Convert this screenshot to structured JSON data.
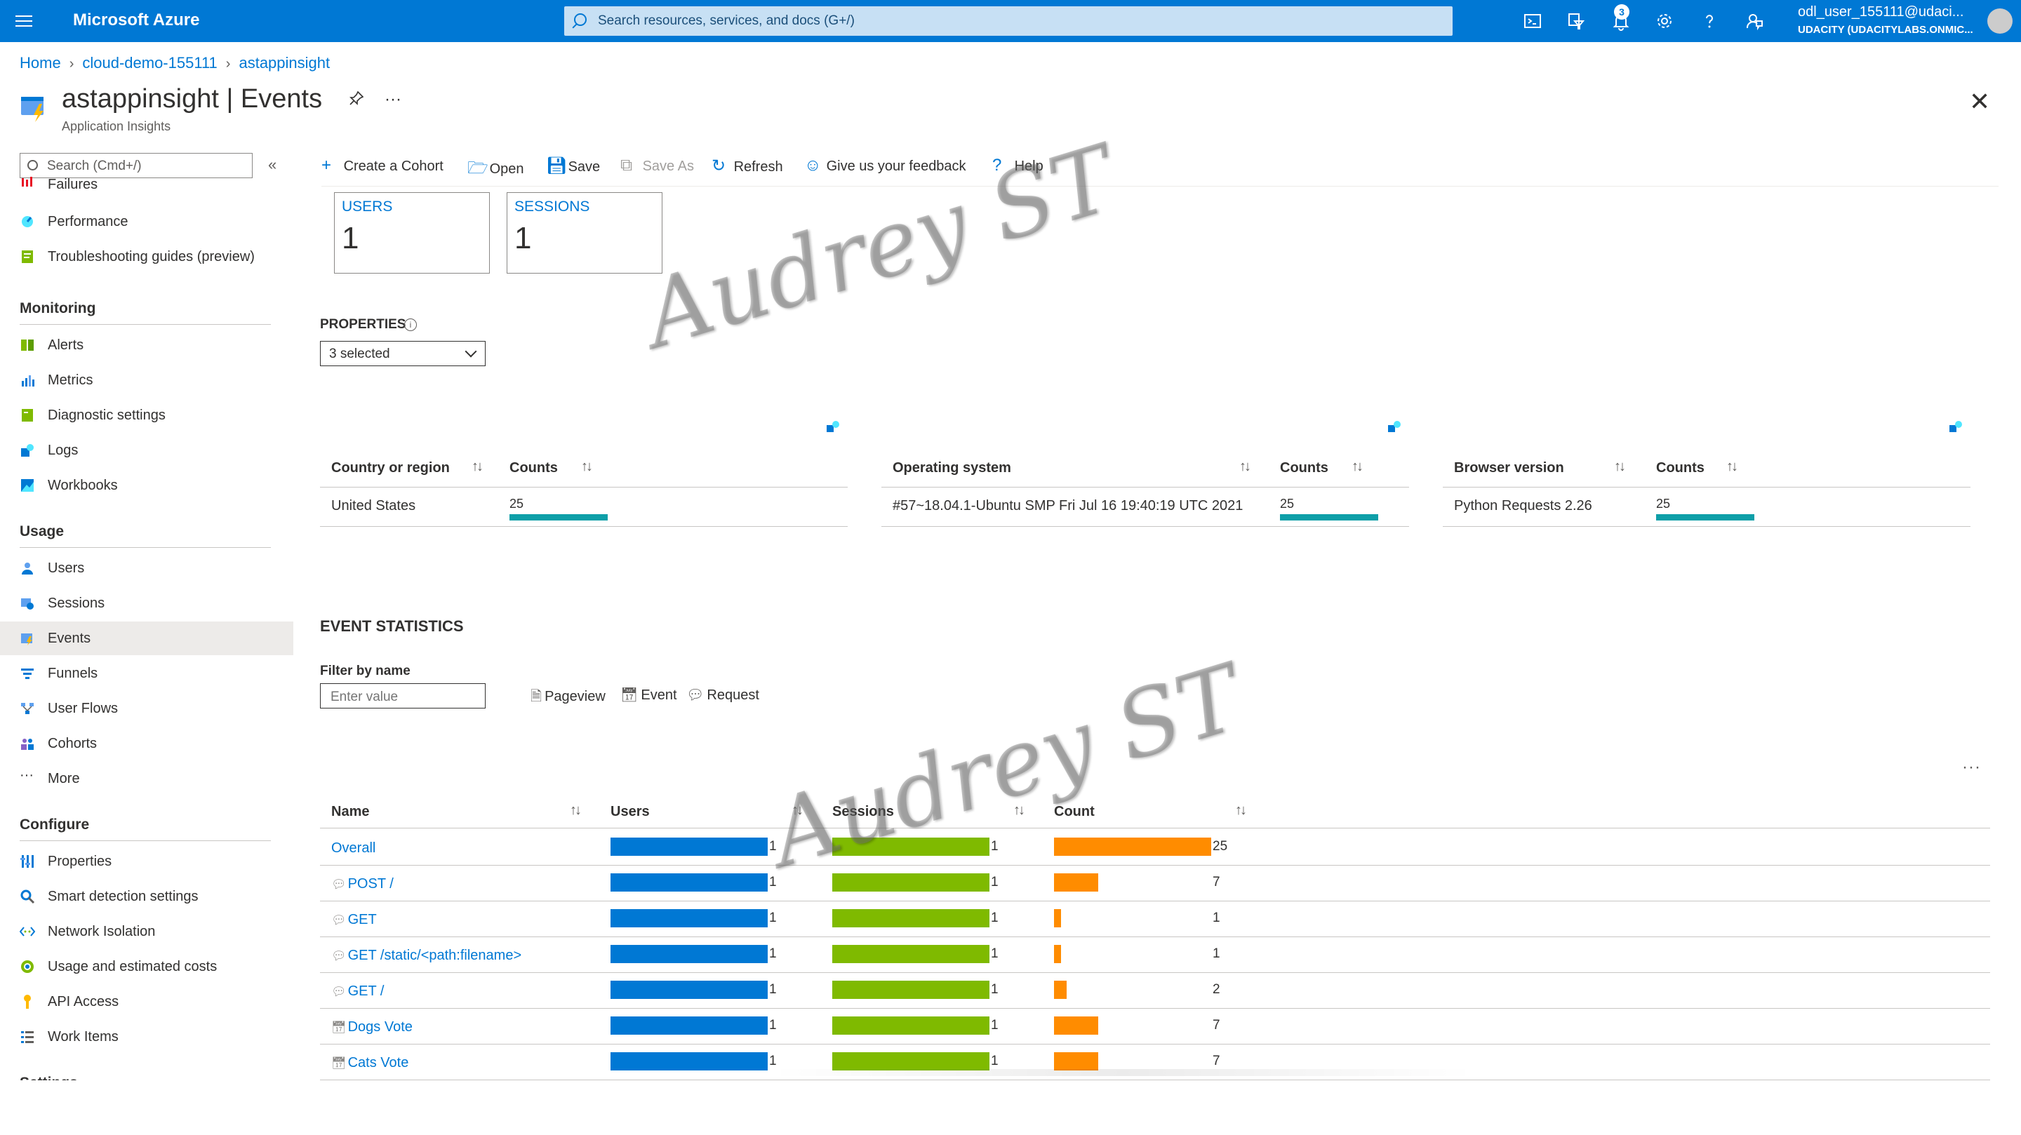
{
  "topbar": {
    "brand": "Microsoft Azure",
    "search_placeholder": "Search resources, services, and docs (G+/)",
    "notifications_count": "3",
    "user_name": "odl_user_155111@udaci...",
    "user_org": "UDACITY (UDACITYLABS.ONMIC...",
    "icons": [
      "cloud-shell-icon",
      "directory-filter-icon",
      "bell-icon",
      "gear-icon",
      "help-icon",
      "feedback-icon"
    ]
  },
  "breadcrumb": [
    "Home",
    "cloud-demo-155111",
    "astappinsight"
  ],
  "header": {
    "title": "astappinsight | Events",
    "subtitle": "Application Insights",
    "more": "···"
  },
  "sidebar": {
    "search_placeholder": "Search (Cmd+/)",
    "collapse": "«",
    "top_items": [
      "Failures",
      "Performance",
      "Troubleshooting guides (preview)"
    ],
    "sections": [
      {
        "title": "Monitoring",
        "items": [
          "Alerts",
          "Metrics",
          "Diagnostic settings",
          "Logs",
          "Workbooks"
        ]
      },
      {
        "title": "Usage",
        "items": [
          "Users",
          "Sessions",
          "Events",
          "Funnels",
          "User Flows",
          "Cohorts",
          "More"
        ]
      },
      {
        "title": "Configure",
        "items": [
          "Properties",
          "Smart detection settings",
          "Network Isolation",
          "Usage and estimated costs",
          "API Access",
          "Work Items"
        ]
      },
      {
        "title": "Settings",
        "items": []
      }
    ],
    "selected": "Events",
    "more_glyph": "···"
  },
  "toolbar": {
    "create_cohort": "Create a Cohort",
    "open": "Open",
    "save": "Save",
    "save_as": "Save As",
    "refresh": "Refresh",
    "feedback": "Give us your feedback",
    "help": "Help"
  },
  "tiles": {
    "users_label": "USERS",
    "users_value": "1",
    "sessions_label": "SESSIONS",
    "sessions_value": "1"
  },
  "properties": {
    "label": "PROPERTIES",
    "info": "i",
    "selected_text": "3 selected"
  },
  "property_tables": [
    {
      "col1": "Country or region",
      "col2": "Counts",
      "value": "United States",
      "count": "25",
      "fill": 1.0
    },
    {
      "col1": "Operating system",
      "col2": "Counts",
      "value": "#57~18.04.1-Ubuntu SMP Fri Jul 16 19:40:19 UTC 2021",
      "count": "25",
      "fill": 1.0
    },
    {
      "col1": "Browser version",
      "col2": "Counts",
      "value": "Python Requests 2.26",
      "count": "25",
      "fill": 1.0
    }
  ],
  "sort_glyph": "↑↓",
  "events": {
    "title": "EVENT STATISTICS",
    "filter_label": "Filter by name",
    "filter_placeholder": "Enter value",
    "legend": [
      "Pageview",
      "Event",
      "Request"
    ],
    "more": "···",
    "columns": [
      "Name",
      "Users",
      "Sessions",
      "Count"
    ],
    "rows": [
      {
        "name": "Overall",
        "type": "overall",
        "users": "1",
        "sessions": "1",
        "count": "25"
      },
      {
        "name": "POST /",
        "type": "request",
        "users": "1",
        "sessions": "1",
        "count": "7"
      },
      {
        "name": "GET",
        "type": "request",
        "users": "1",
        "sessions": "1",
        "count": "1"
      },
      {
        "name": "GET /static/<path:filename>",
        "type": "request",
        "users": "1",
        "sessions": "1",
        "count": "1"
      },
      {
        "name": "GET /",
        "type": "request",
        "users": "1",
        "sessions": "1",
        "count": "2"
      },
      {
        "name": "Dogs Vote",
        "type": "event",
        "users": "1",
        "sessions": "1",
        "count": "7"
      },
      {
        "name": "Cats Vote",
        "type": "event",
        "users": "1",
        "sessions": "1",
        "count": "7"
      }
    ],
    "count_max": 25,
    "colors": {
      "users": "#0078d4",
      "sessions": "#7fba00",
      "count": "#ff8c00"
    }
  },
  "watermark": "Audrey ST"
}
